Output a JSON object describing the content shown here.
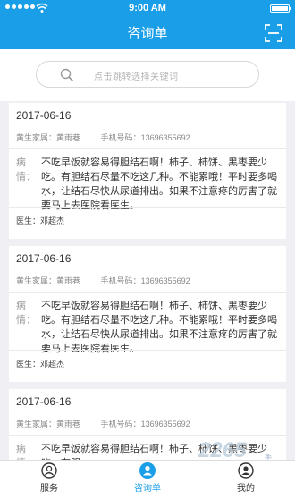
{
  "status": {
    "time": "9:00 AM"
  },
  "header": {
    "title": "咨询单"
  },
  "search": {
    "placeholder": "点击跳转选择关键词"
  },
  "records": [
    {
      "date": "2017-06-16",
      "family_label": "黄生家属：",
      "family_name": "黄雨巷",
      "phone_label": "手机号码：",
      "phone": "13696355692",
      "condition_label": "病情：",
      "condition": "不吃早饭就容易得胆结石啊！柿子、柿饼、黑枣要少吃。有胆结石尽量不吃这几种。不能累哦！平时要多喝水，让结石尽快从尿道排出。如果不注意疼的厉害了就要马上去医院看医生。",
      "doctor_label": "医生：",
      "doctor": "邓超杰"
    },
    {
      "date": "2017-06-16",
      "family_label": "黄生家属：",
      "family_name": "黄雨巷",
      "phone_label": "手机号码：",
      "phone": "13696355692",
      "condition_label": "病情：",
      "condition": "不吃早饭就容易得胆结石啊！柿子、柿饼、黑枣要少吃。有胆结石尽量不吃这几种。不能累哦！平时要多喝水，让结石尽快从尿道排出。如果不注意疼的厉害了就要马上去医院看医生。",
      "doctor_label": "医生：",
      "doctor": "邓超杰"
    },
    {
      "date": "2017-06-16",
      "family_label": "黄生家属：",
      "family_name": "黄雨巷",
      "phone_label": "手机号码：",
      "phone": "13696355692",
      "condition_label": "病情：",
      "condition": "不吃早饭就容易得胆结石啊！柿子、柿饼、黑枣要少吃。有胆",
      "doctor_label": "",
      "doctor": ""
    }
  ],
  "tabs": [
    {
      "label": "服务",
      "icon": "service-icon"
    },
    {
      "label": "咨询单",
      "icon": "consult-icon"
    },
    {
      "label": "我的",
      "icon": "profile-icon"
    }
  ],
  "watermark": {
    "main": "2265",
    "sub": "手游网"
  },
  "colors": {
    "primary": "#1a9ee8",
    "background": "#efeff4"
  }
}
